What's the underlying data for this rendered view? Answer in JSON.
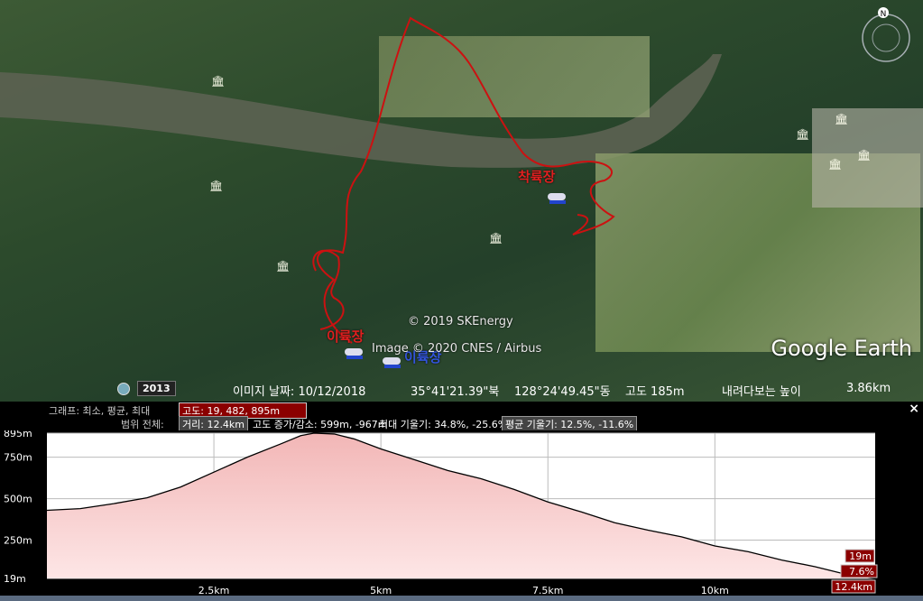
{
  "map": {
    "copyright_sk": "© 2019 SKEnergy",
    "copyright_image": "Image © 2020 CNES / Airbus",
    "logo": "Google Earth",
    "landing_label": "착륙장",
    "takeoff_label": "이륙장",
    "takeoff_label2": "이륙장",
    "compass_north": "N"
  },
  "statusbar": {
    "year": "2013",
    "image_date": "이미지 날짜: 10/12/2018",
    "latitude": "35°41'21.39\"북",
    "longitude": "128°24'49.45\"동",
    "altitude": "고도 185m",
    "eye_alt_label": "내려다보는 높이",
    "eye_alt_value": "3.86km"
  },
  "graph": {
    "row1_label": "그래프: 최소, 평균, 최대",
    "row1_value": "고도: 19, 482, 895m",
    "row2_label": "범위 전체:",
    "row2_distance": "거리: 12.4km",
    "row2_elev": "고도 증가/감소: 599m, -967m",
    "row2_slope_max": "최대 기울기: 34.8%, -25.6%",
    "row2_slope_avg": "평균 기울기: 12.5%, -11.6%",
    "close": "×"
  },
  "chart_data": {
    "type": "area",
    "xlabel": "",
    "ylabel": "",
    "x_ticks": [
      "2.5km",
      "5km",
      "7.5km",
      "10km"
    ],
    "x_tick_values": [
      2.5,
      5,
      7.5,
      10
    ],
    "y_ticks": [
      "895m",
      "750m",
      "500m",
      "250m",
      "19m"
    ],
    "y_tick_values": [
      895,
      750,
      500,
      250,
      19
    ],
    "xlim": [
      0,
      12.4
    ],
    "ylim": [
      19,
      895
    ],
    "end_labels": [
      "19m",
      "7.6%",
      "12.4km"
    ],
    "series": [
      {
        "x": [
          0,
          0.5,
          1.0,
          1.5,
          2.0,
          2.5,
          3.0,
          3.5,
          3.8,
          4.0,
          4.3,
          4.6,
          5.0,
          5.5,
          6.0,
          6.5,
          7.0,
          7.5,
          8.0,
          8.5,
          9.0,
          9.5,
          10.0,
          10.5,
          11.0,
          11.5,
          12.0,
          12.4
        ],
        "y": [
          430,
          440,
          470,
          505,
          570,
          660,
          750,
          830,
          880,
          895,
          890,
          860,
          800,
          735,
          670,
          620,
          555,
          480,
          420,
          355,
          310,
          270,
          215,
          180,
          130,
          90,
          40,
          19
        ]
      }
    ],
    "fill_color": "#f7c9c9",
    "line_color": "#000000",
    "grid": true
  },
  "colors": {
    "track": "#cc1111",
    "panel_bg": "#000000",
    "value_box": "#8b0000"
  }
}
